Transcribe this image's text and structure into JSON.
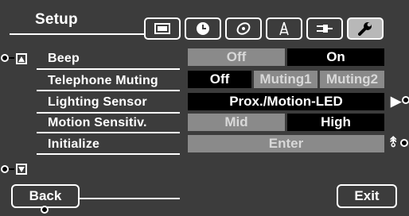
{
  "header": {
    "title": "Setup"
  },
  "tabs": [
    {
      "icon": "display-icon",
      "active": false
    },
    {
      "icon": "clock-icon",
      "active": false
    },
    {
      "icon": "disc-icon",
      "active": false
    },
    {
      "icon": "antenna-icon",
      "active": false
    },
    {
      "icon": "connector-icon",
      "active": false
    },
    {
      "icon": "wrench-icon",
      "active": true
    }
  ],
  "settings": {
    "beep": {
      "label": "Beep",
      "options": [
        "Off",
        "On"
      ],
      "selected": "On"
    },
    "telephone_muting": {
      "label": "Telephone Muting",
      "options": [
        "Off",
        "Muting1",
        "Muting2"
      ],
      "selected": "Off"
    },
    "lighting_sensor": {
      "label": "Lighting Sensor",
      "value": "Prox./Motion-LED"
    },
    "motion_sensitivity": {
      "label": "Motion Sensitiv.",
      "options": [
        "Mid",
        "High"
      ],
      "selected": "High"
    },
    "initialize": {
      "label": "Initialize",
      "button": "Enter"
    }
  },
  "footer": {
    "back_label": "Back",
    "exit_label": "Exit"
  },
  "colors": {
    "background": "#3c3c3c",
    "selected": "#000000",
    "unselected": "#8a8a8a",
    "foreground": "#ffffff"
  }
}
